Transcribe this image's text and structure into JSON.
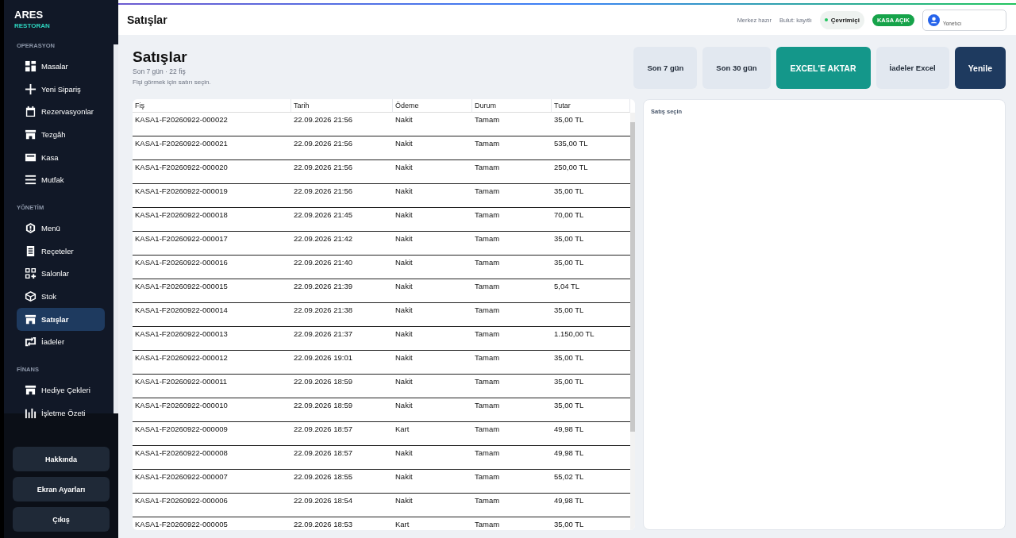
{
  "sidebar": {
    "brand": "ARES",
    "subtitle": "RESTORAN",
    "sections": [
      {
        "title": "OPERASYON",
        "items": [
          {
            "label": "Masalar",
            "selected": false
          },
          {
            "label": "Yeni Sipariş",
            "selected": false
          },
          {
            "label": "Rezervasyonlar",
            "selected": false
          },
          {
            "label": "Tezgâh",
            "selected": false
          },
          {
            "label": "Kasa",
            "selected": false
          },
          {
            "label": "Mutfak",
            "selected": false
          }
        ]
      },
      {
        "title": "YÖNETİM",
        "items": [
          {
            "label": "Menü",
            "selected": false
          },
          {
            "label": "Reçeteler",
            "selected": false
          },
          {
            "label": "Salonlar",
            "selected": false
          },
          {
            "label": "Stok",
            "selected": false
          },
          {
            "label": "Satışlar",
            "selected": true
          },
          {
            "label": "İadeler",
            "selected": false
          }
        ]
      },
      {
        "title": "FİNANS",
        "items": [
          {
            "label": "Hediye Çekleri",
            "selected": false
          },
          {
            "label": "İşletme Özeti",
            "selected": false
          }
        ]
      }
    ],
    "bottom_buttons": [
      "Hakkında",
      "Ekran Ayarları",
      "Çıkış"
    ]
  },
  "header": {
    "title": "Satışlar",
    "statuses": [
      "Merkez hazır",
      "Bulut: kayıtlı"
    ],
    "connection": "Çevrimiçi",
    "register_badge": "KASA AÇIK",
    "user": "Yonetıcı"
  },
  "page": {
    "title": "Satışlar",
    "subtitle": "Son 7 gün · 22 fiş",
    "hint": "Fişi görmek için satırı seçin.",
    "buttons": [
      {
        "label": "Son 7 gün",
        "kind": "period"
      },
      {
        "label": "Son 30 gün",
        "kind": "period"
      },
      {
        "label": "EXCEL'E AKTAR",
        "kind": "export"
      },
      {
        "label": "İadeler Excel",
        "kind": "period"
      },
      {
        "label": "Yenile",
        "kind": "refresh"
      }
    ],
    "table": {
      "columns": [
        "Fiş",
        "Tarih",
        "Ödeme",
        "Durum",
        "Tutar"
      ],
      "rows": [
        [
          "KASA1-F20260922-000022",
          "22.09.2026 21:56",
          "Nakit",
          "Tamam",
          "35,00 TL"
        ],
        [
          "KASA1-F20260922-000021",
          "22.09.2026 21:56",
          "Nakit",
          "Tamam",
          "535,00 TL"
        ],
        [
          "KASA1-F20260922-000020",
          "22.09.2026 21:56",
          "Nakit",
          "Tamam",
          "250,00 TL"
        ],
        [
          "KASA1-F20260922-000019",
          "22.09.2026 21:56",
          "Nakit",
          "Tamam",
          "35,00 TL"
        ],
        [
          "KASA1-F20260922-000018",
          "22.09.2026 21:45",
          "Nakit",
          "Tamam",
          "70,00 TL"
        ],
        [
          "KASA1-F20260922-000017",
          "22.09.2026 21:42",
          "Nakit",
          "Tamam",
          "35,00 TL"
        ],
        [
          "KASA1-F20260922-000016",
          "22.09.2026 21:40",
          "Nakit",
          "Tamam",
          "35,00 TL"
        ],
        [
          "KASA1-F20260922-000015",
          "22.09.2026 21:39",
          "Nakit",
          "Tamam",
          "5,04 TL"
        ],
        [
          "KASA1-F20260922-000014",
          "22.09.2026 21:38",
          "Nakit",
          "Tamam",
          "35,00 TL"
        ],
        [
          "KASA1-F20260922-000013",
          "22.09.2026 21:37",
          "Nakit",
          "Tamam",
          "1.150,00 TL"
        ],
        [
          "KASA1-F20260922-000012",
          "22.09.2026 19:01",
          "Nakit",
          "Tamam",
          "35,00 TL"
        ],
        [
          "KASA1-F20260922-000011",
          "22.09.2026 18:59",
          "Nakit",
          "Tamam",
          "35,00 TL"
        ],
        [
          "KASA1-F20260922-000010",
          "22.09.2026 18:59",
          "Nakit",
          "Tamam",
          "35,00 TL"
        ],
        [
          "KASA1-F20260922-000009",
          "22.09.2026 18:57",
          "Kart",
          "Tamam",
          "49,98 TL"
        ],
        [
          "KASA1-F20260922-000008",
          "22.09.2026 18:57",
          "Nakit",
          "Tamam",
          "49,98 TL"
        ],
        [
          "KASA1-F20260922-000007",
          "22.09.2026 18:55",
          "Nakit",
          "Tamam",
          "55,02 TL"
        ],
        [
          "KASA1-F20260922-000006",
          "22.09.2026 18:54",
          "Nakit",
          "Tamam",
          "49,98 TL"
        ],
        [
          "KASA1-F20260922-000005",
          "22.09.2026 18:53",
          "Kart",
          "Tamam",
          "35,00 TL"
        ]
      ]
    },
    "detail": {
      "placeholder": "Satış seçin"
    }
  }
}
